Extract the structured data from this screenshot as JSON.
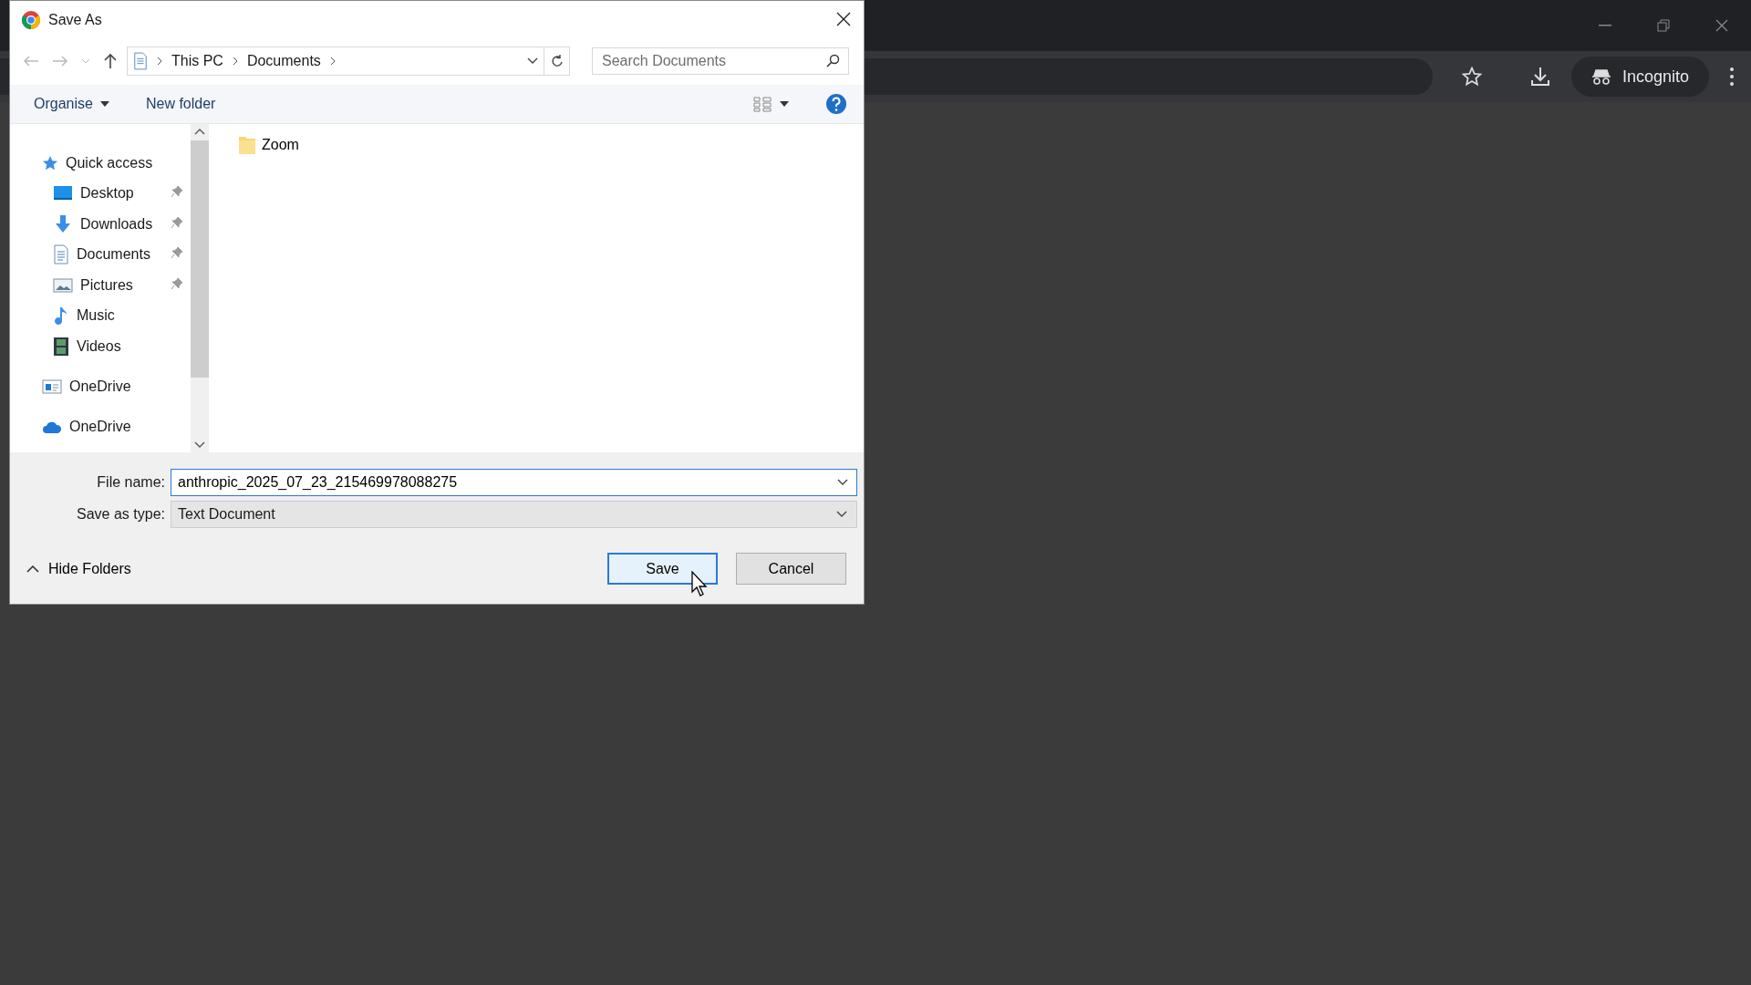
{
  "browser": {
    "profile_label": "Incognito"
  },
  "dialog": {
    "title": "Save As",
    "breadcrumb": [
      "This PC",
      "Documents"
    ],
    "search": {
      "placeholder": "Search Documents"
    },
    "toolbar": {
      "organise": "Organise",
      "new_folder": "New folder"
    },
    "nav": [
      {
        "label": "Quick access",
        "kind": "star",
        "children": [
          {
            "label": "Desktop",
            "kind": "desktop",
            "pinned": true
          },
          {
            "label": "Downloads",
            "kind": "download",
            "pinned": true
          },
          {
            "label": "Documents",
            "kind": "document",
            "pinned": true
          },
          {
            "label": "Pictures",
            "kind": "pictures",
            "pinned": true
          },
          {
            "label": "Music",
            "kind": "music",
            "pinned": false
          },
          {
            "label": "Videos",
            "kind": "videos",
            "pinned": false
          }
        ]
      },
      {
        "label": "OneDrive",
        "kind": "drive"
      },
      {
        "label": "OneDrive",
        "kind": "cloud"
      }
    ],
    "files": [
      {
        "name": "Zoom",
        "kind": "folder"
      }
    ],
    "file_name": {
      "label": "File name:",
      "value": "anthropic_2025_07_23_215469978088275"
    },
    "save_as_type": {
      "label": "Save as type:",
      "value": "Text Document"
    },
    "hide_folders": "Hide Folders",
    "buttons": [
      {
        "label": "Save",
        "default": true
      },
      {
        "label": "Cancel",
        "default": false
      }
    ]
  }
}
